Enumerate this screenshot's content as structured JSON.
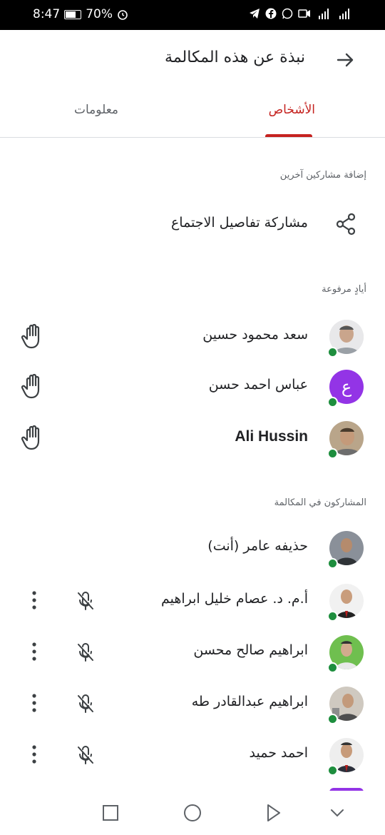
{
  "status": {
    "time": "8:47",
    "battery": "70%"
  },
  "header": {
    "title": "نبذة عن هذه المكالمة"
  },
  "tabs": [
    {
      "label": "الأشخاص"
    },
    {
      "label": "معلومات"
    }
  ],
  "add_section": {
    "label": "إضافة مشاركين آخرين",
    "share_label": "مشاركة تفاصيل الاجتماع"
  },
  "raised_section": {
    "label": "أيادٍ مرفوعة"
  },
  "raised": [
    {
      "name": "سعد محمود حسين"
    },
    {
      "name": "عباس احمد حسن",
      "initial": "ع"
    },
    {
      "name": "Ali Hussin"
    }
  ],
  "call_section": {
    "label": "المشاركون في المكالمة"
  },
  "participants": [
    {
      "name": "حذيفه عامر (أنت)"
    },
    {
      "name": "أ.م. د. عصام خليل ابراهيم"
    },
    {
      "name": "ابراهيم صالح محسن"
    },
    {
      "name": "ابراهيم عبدالقادر طه"
    },
    {
      "name": "احمد حميد"
    }
  ],
  "colors": {
    "accent": "#c5221f",
    "presence": "#1e8e3e",
    "avatar_purple": "#9334e6"
  }
}
